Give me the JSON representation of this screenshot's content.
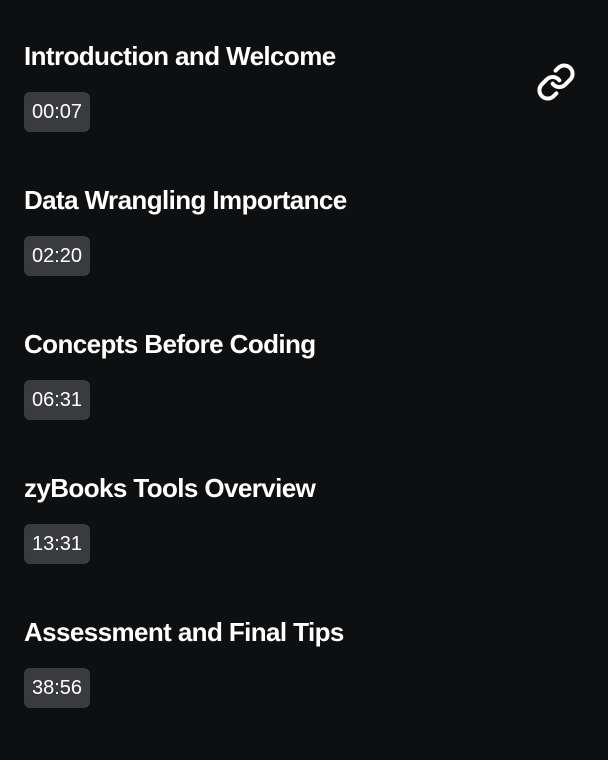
{
  "chapters": [
    {
      "title": "Introduction and Welcome",
      "timestamp": "00:07"
    },
    {
      "title": "Data Wrangling Importance",
      "timestamp": "02:20"
    },
    {
      "title": "Concepts Before Coding",
      "timestamp": "06:31"
    },
    {
      "title": "zyBooks Tools Overview",
      "timestamp": "13:31"
    },
    {
      "title": "Assessment and Final Tips",
      "timestamp": "38:56"
    }
  ],
  "icons": {
    "copy_link": "link-icon"
  },
  "colors": {
    "background": "#0e0f11",
    "badge_background": "#3a3b3e",
    "text": "#ffffff"
  }
}
